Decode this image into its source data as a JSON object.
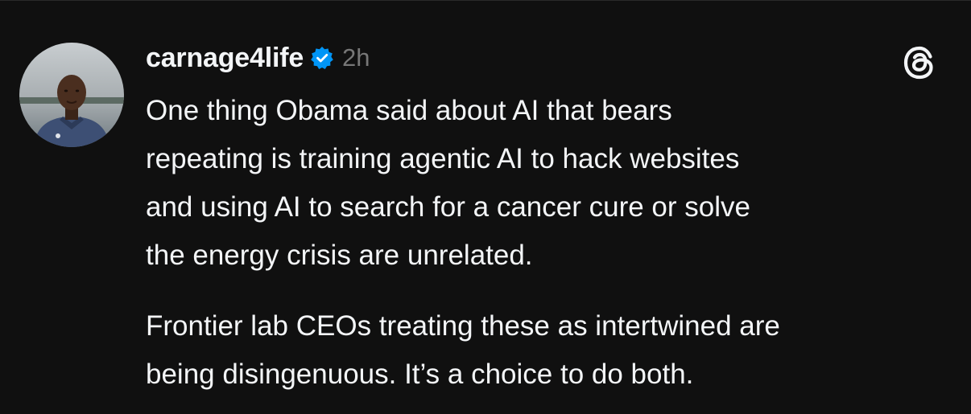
{
  "post": {
    "author": {
      "username": "carnage4life",
      "verified": true,
      "avatar_icon": "profile-photo"
    },
    "timestamp": "2h",
    "app_icon": "threads-logo-icon",
    "paragraphs": [
      "One thing Obama said about AI that bears\nrepeating is training agentic AI to hack websites\nand using AI to search for a cancer cure or solve\nthe energy crisis are unrelated.",
      "Frontier lab CEOs treating these as intertwined are\nbeing disingenuous. It’s a choice to do both."
    ]
  },
  "colors": {
    "background": "#101010",
    "text": "#f3f5f7",
    "muted": "#777777",
    "verified_badge": "#0095f6"
  }
}
